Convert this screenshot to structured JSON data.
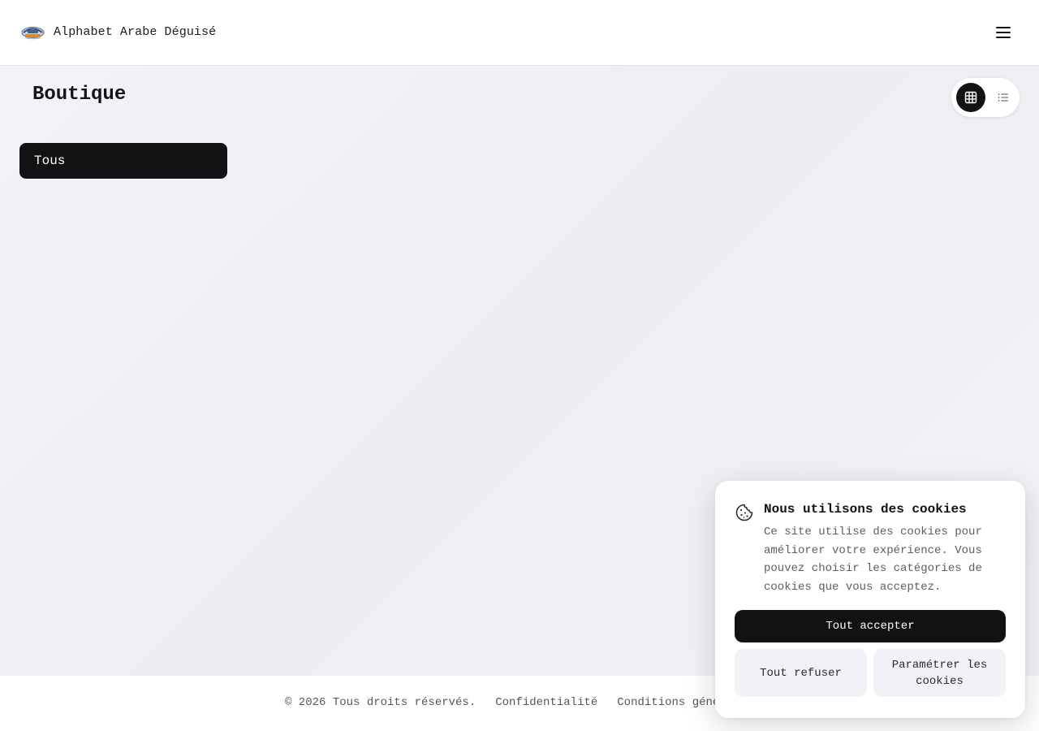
{
  "header": {
    "brand_name": "Alphabet Arabe Déguisé",
    "logo_icon": "brand-logo-icon",
    "menu_icon": "hamburger-menu-icon"
  },
  "main": {
    "title": "Boutique",
    "view_toggle": {
      "grid_icon": "grid-view-icon",
      "list_icon": "list-view-icon",
      "active": "grid"
    },
    "categories": [
      {
        "label": "Tous",
        "active": true
      }
    ]
  },
  "footer": {
    "copyright": "© 2026 Tous droits réservés.",
    "links": [
      "Confidentialité",
      "Conditions générales"
    ]
  },
  "cookie_banner": {
    "icon": "cookie-icon",
    "title": "Nous utilisons des cookies",
    "text": "Ce site utilise des cookies pour améliorer votre expérience. Vous pouvez choisir les catégories de cookies que vous acceptez.",
    "accept_label": "Tout accepter",
    "refuse_label": "Tout refuser",
    "settings_label": "Paramétrer les cookies"
  },
  "colors": {
    "primary": "#121215",
    "background": "#eef0f3",
    "muted_button": "#f1f2f5",
    "muted_text": "#5c5e66"
  }
}
